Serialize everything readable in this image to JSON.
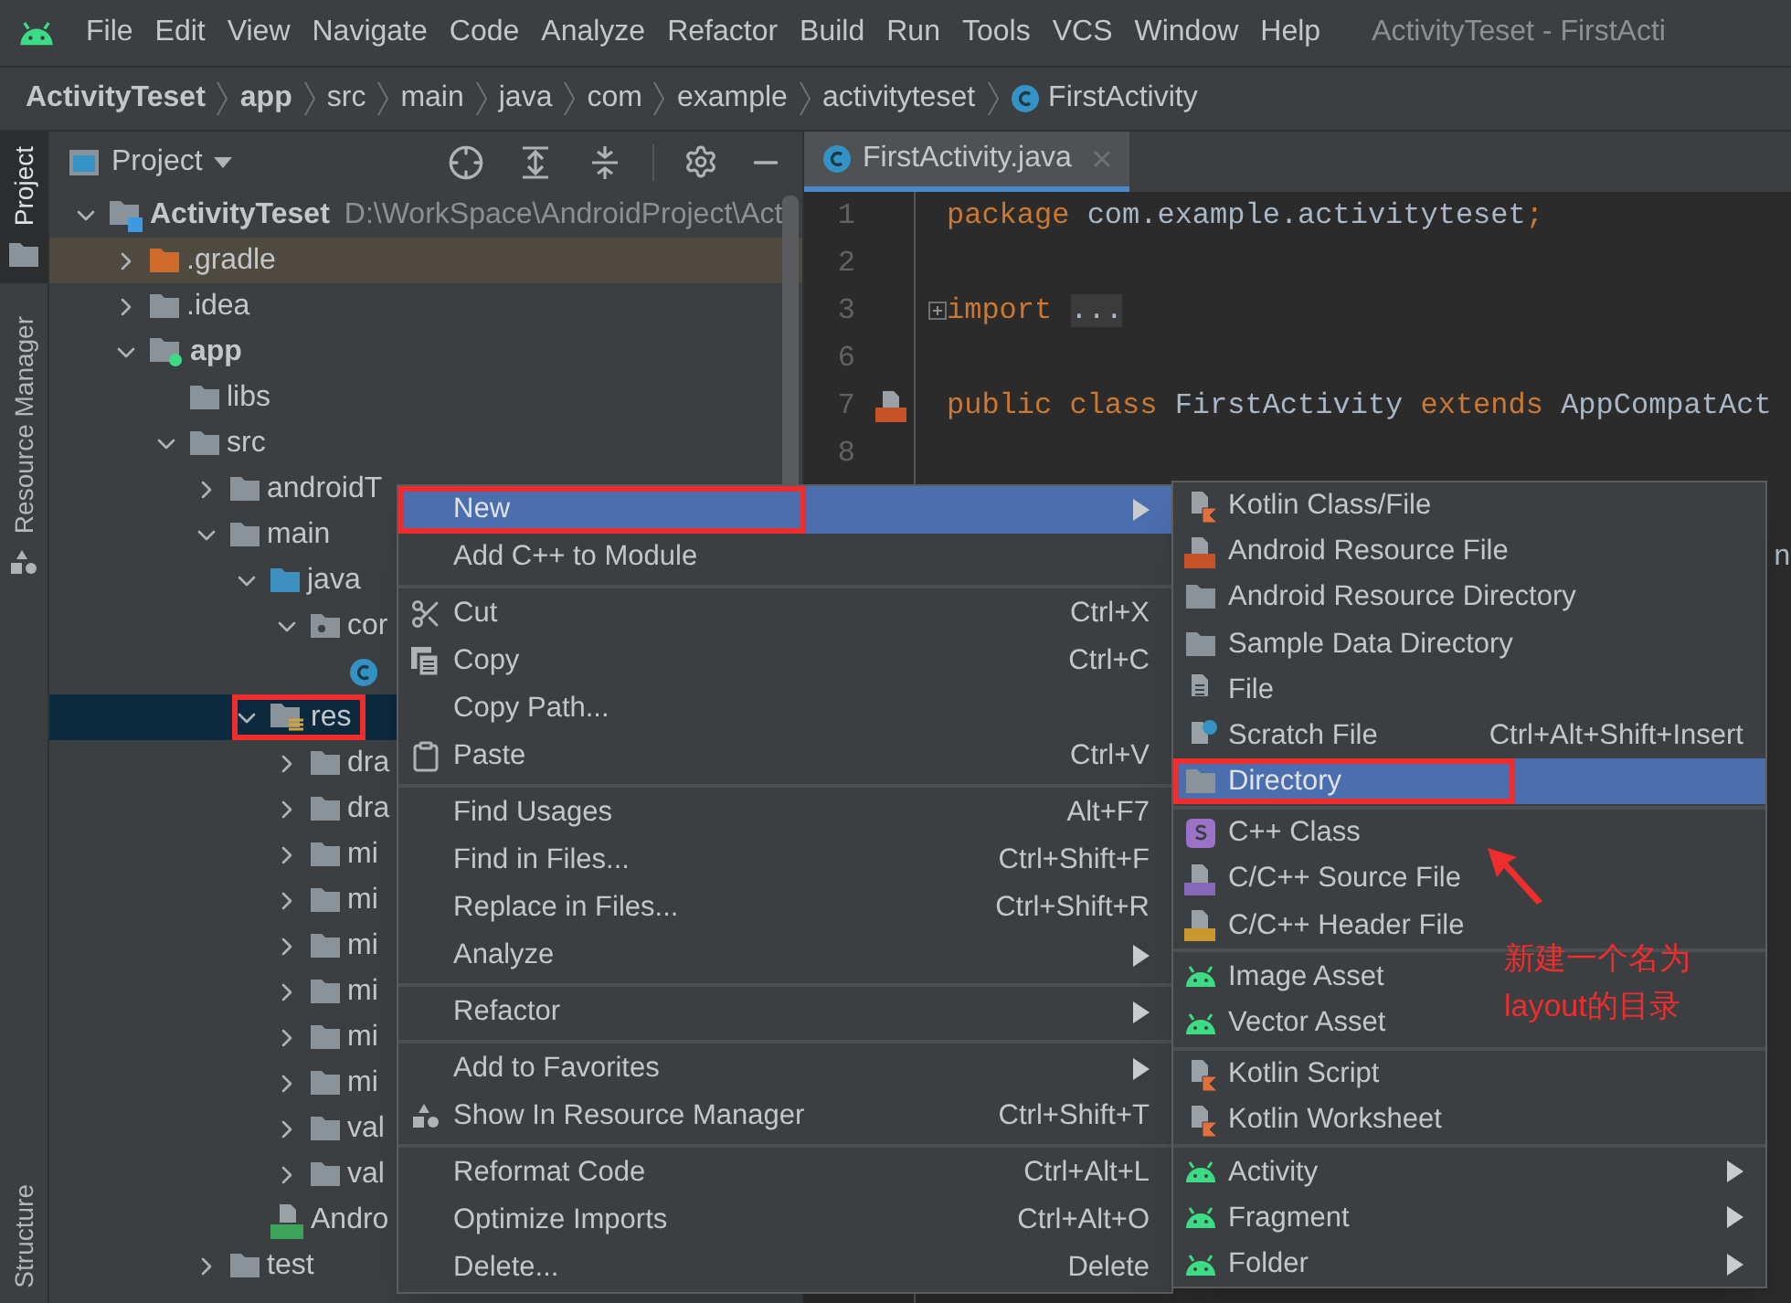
{
  "menu_bar": {
    "items": [
      "File",
      "Edit",
      "View",
      "Navigate",
      "Code",
      "Analyze",
      "Refactor",
      "Build",
      "Run",
      "Tools",
      "VCS",
      "Window",
      "Help"
    ],
    "window_title": "ActivityTeset - FirstActi"
  },
  "breadcrumb": [
    {
      "label": "ActivityTeset",
      "bold": true,
      "kind": "plain"
    },
    {
      "label": "app",
      "bold": true,
      "kind": "plain"
    },
    {
      "label": "src",
      "bold": false,
      "kind": "plain"
    },
    {
      "label": "main",
      "bold": false,
      "kind": "plain"
    },
    {
      "label": "java",
      "bold": false,
      "kind": "plain"
    },
    {
      "label": "com",
      "bold": false,
      "kind": "plain"
    },
    {
      "label": "example",
      "bold": false,
      "kind": "plain"
    },
    {
      "label": "activityteset",
      "bold": false,
      "kind": "plain"
    },
    {
      "label": "FirstActivity",
      "bold": false,
      "kind": "class"
    }
  ],
  "side_stripe": [
    {
      "label": "Project",
      "selected": true
    },
    {
      "label": "Resource Manager",
      "selected": false
    },
    {
      "label": "Structure",
      "selected": false
    }
  ],
  "project_panel": {
    "view": "Project",
    "tree": [
      {
        "label": "ActivityTeset",
        "path": "D:\\WorkSpace\\AndroidProject\\Act",
        "kind": "project",
        "expanded": true,
        "selected": false,
        "framed": false,
        "children": [
          {
            "label": ".gradle",
            "kind": "excluded",
            "expanded": false,
            "selected": false,
            "framed": false
          },
          {
            "label": ".idea",
            "kind": "folder",
            "expanded": false,
            "selected": false,
            "framed": false
          },
          {
            "label": "app",
            "kind": "module",
            "expanded": true,
            "selected": false,
            "framed": false,
            "children": [
              {
                "label": "libs",
                "kind": "folder",
                "selected": false,
                "framed": false
              },
              {
                "label": "src",
                "kind": "folder",
                "expanded": true,
                "selected": false,
                "framed": false,
                "children": [
                  {
                    "label": "androidT",
                    "kind": "folder",
                    "expanded": false,
                    "selected": false,
                    "framed": false
                  },
                  {
                    "label": "main",
                    "kind": "folder",
                    "expanded": true,
                    "selected": false,
                    "framed": false,
                    "children": [
                      {
                        "label": "java",
                        "kind": "source",
                        "expanded": true,
                        "selected": false,
                        "framed": false,
                        "children": [
                          {
                            "label": "cor",
                            "kind": "package",
                            "expanded": true,
                            "selected": false,
                            "framed": false,
                            "children": [
                              {
                                "kind": "class",
                                "selected": false,
                                "framed": false
                              }
                            ]
                          }
                        ]
                      },
                      {
                        "label": "res",
                        "kind": "resources",
                        "expanded": true,
                        "selected": true,
                        "framed": true,
                        "children": [
                          {
                            "label": "dra",
                            "kind": "folder",
                            "expanded": false,
                            "selected": false,
                            "framed": false
                          },
                          {
                            "label": "dra",
                            "kind": "folder",
                            "expanded": false,
                            "selected": false,
                            "framed": false
                          },
                          {
                            "label": "mi",
                            "kind": "folder",
                            "expanded": false,
                            "selected": false,
                            "framed": false
                          },
                          {
                            "label": "mi",
                            "kind": "folder",
                            "expanded": false,
                            "selected": false,
                            "framed": false
                          },
                          {
                            "label": "mi",
                            "kind": "folder",
                            "expanded": false,
                            "selected": false,
                            "framed": false
                          },
                          {
                            "label": "mi",
                            "kind": "folder",
                            "expanded": false,
                            "selected": false,
                            "framed": false
                          },
                          {
                            "label": "mi",
                            "kind": "folder",
                            "expanded": false,
                            "selected": false,
                            "framed": false
                          },
                          {
                            "label": "mi",
                            "kind": "folder",
                            "expanded": false,
                            "selected": false,
                            "framed": false
                          },
                          {
                            "label": "val",
                            "kind": "folder",
                            "expanded": false,
                            "selected": false,
                            "framed": false
                          },
                          {
                            "label": "val",
                            "kind": "folder",
                            "expanded": false,
                            "selected": false,
                            "framed": false
                          }
                        ]
                      },
                      {
                        "label": "Andro",
                        "kind": "manifest",
                        "selected": false,
                        "framed": false
                      }
                    ]
                  },
                  {
                    "label": "test",
                    "kind": "folder",
                    "expanded": false,
                    "selected": false,
                    "framed": false
                  }
                ]
              }
            ]
          }
        ]
      }
    ]
  },
  "editor": {
    "tab": {
      "label": "FirstActivity.java",
      "selected": true
    },
    "lines": [
      {
        "number": "1",
        "tokens": [
          {
            "kind": "keyword",
            "text": "package"
          },
          {
            "kind": "plain",
            "text": " com.example.activityteset"
          },
          {
            "kind": "keyword",
            "text": ";"
          }
        ]
      },
      {
        "number": "2"
      },
      {
        "number": "3",
        "fold": true,
        "tokens": [
          {
            "kind": "keyword",
            "text": "import"
          },
          {
            "kind": "folded",
            "text": "..."
          }
        ]
      },
      {
        "number": "6"
      },
      {
        "number": "7",
        "gutter_icon": true,
        "tokens": [
          {
            "kind": "keyword",
            "text": "public class"
          },
          {
            "kind": "plain",
            "text": " FirstActivity "
          },
          {
            "kind": "keyword",
            "text": "extends"
          },
          {
            "kind": "plain",
            "text": " AppCompatAct"
          }
        ]
      },
      {
        "number": "8"
      }
    ],
    "peek_text": "n"
  },
  "context_menu": {
    "items": [
      {
        "kind": "plain",
        "label": "New",
        "selected": true,
        "framed": true,
        "submenu": true
      },
      {
        "kind": "plain",
        "label": "Add C++ to Module",
        "selected": false,
        "framed": false,
        "submenu": false
      },
      {
        "kind": "separator"
      },
      {
        "kind": "scissors",
        "label": "Cut",
        "shortcut": "Ctrl+X",
        "selected": false,
        "framed": false,
        "submenu": false
      },
      {
        "kind": "copy",
        "label": "Copy",
        "shortcut": "Ctrl+C",
        "selected": false,
        "framed": false,
        "submenu": false
      },
      {
        "kind": "plain",
        "label": "Copy Path...",
        "selected": false,
        "framed": false,
        "submenu": false
      },
      {
        "kind": "clipboard",
        "label": "Paste",
        "shortcut": "Ctrl+V",
        "selected": false,
        "framed": false,
        "submenu": false
      },
      {
        "kind": "separator"
      },
      {
        "kind": "plain",
        "label": "Find Usages",
        "shortcut": "Alt+F7",
        "selected": false,
        "framed": false,
        "submenu": false
      },
      {
        "kind": "plain",
        "label": "Find in Files...",
        "shortcut": "Ctrl+Shift+F",
        "selected": false,
        "framed": false,
        "submenu": false
      },
      {
        "kind": "plain",
        "label": "Replace in Files...",
        "shortcut": "Ctrl+Shift+R",
        "selected": false,
        "framed": false,
        "submenu": false
      },
      {
        "kind": "plain",
        "label": "Analyze",
        "selected": false,
        "framed": false,
        "submenu": true
      },
      {
        "kind": "separator"
      },
      {
        "kind": "plain",
        "label": "Refactor",
        "selected": false,
        "framed": false,
        "submenu": true
      },
      {
        "kind": "separator"
      },
      {
        "kind": "plain",
        "label": "Add to Favorites",
        "selected": false,
        "framed": false,
        "submenu": true
      },
      {
        "kind": "shapes",
        "label": "Show In Resource Manager",
        "shortcut": "Ctrl+Shift+T",
        "selected": false,
        "framed": false,
        "submenu": false
      },
      {
        "kind": "separator"
      },
      {
        "kind": "plain",
        "label": "Reformat Code",
        "shortcut": "Ctrl+Alt+L",
        "selected": false,
        "framed": false,
        "submenu": false
      },
      {
        "kind": "plain",
        "label": "Optimize Imports",
        "shortcut": "Ctrl+Alt+O",
        "selected": false,
        "framed": false,
        "submenu": false
      },
      {
        "kind": "plain",
        "label": "Delete...",
        "shortcut": "Delete",
        "selected": false,
        "framed": false,
        "submenu": false
      }
    ]
  },
  "new_submenu": {
    "items": [
      {
        "kind": "kotlin",
        "label": "Kotlin Class/File",
        "selected": false,
        "framed": false,
        "submenu": false
      },
      {
        "kind": "resource-file",
        "label": "Android Resource File",
        "selected": false,
        "framed": false,
        "submenu": false
      },
      {
        "kind": "folder",
        "label": "Android Resource Directory",
        "selected": false,
        "framed": false,
        "submenu": false
      },
      {
        "kind": "folder",
        "label": "Sample Data Directory",
        "selected": false,
        "framed": false,
        "submenu": false
      },
      {
        "kind": "file",
        "label": "File",
        "selected": false,
        "framed": false,
        "submenu": false
      },
      {
        "kind": "scratch",
        "label": "Scratch File",
        "shortcut": "Ctrl+Alt+Shift+Insert",
        "selected": false,
        "framed": false,
        "submenu": false
      },
      {
        "kind": "folder",
        "label": "Directory",
        "selected": true,
        "framed": true,
        "submenu": false
      },
      {
        "kind": "separator"
      },
      {
        "kind": "s-class",
        "label": "C++ Class",
        "selected": false,
        "framed": false,
        "submenu": false
      },
      {
        "kind": "cpp",
        "label": "C/C++ Source File",
        "selected": false,
        "framed": false,
        "submenu": false
      },
      {
        "kind": "header",
        "label": "C/C++ Header File",
        "selected": false,
        "framed": false,
        "submenu": false
      },
      {
        "kind": "separator"
      },
      {
        "kind": "android",
        "label": "Image Asset",
        "selected": false,
        "framed": false,
        "submenu": false
      },
      {
        "kind": "android",
        "label": "Vector Asset",
        "selected": false,
        "framed": false,
        "submenu": false
      },
      {
        "kind": "separator"
      },
      {
        "kind": "kotlin",
        "label": "Kotlin Script",
        "selected": false,
        "framed": false,
        "submenu": false
      },
      {
        "kind": "kotlin",
        "label": "Kotlin Worksheet",
        "selected": false,
        "framed": false,
        "submenu": false
      },
      {
        "kind": "separator"
      },
      {
        "kind": "android",
        "label": "Activity",
        "selected": false,
        "framed": false,
        "submenu": true
      },
      {
        "kind": "android",
        "label": "Fragment",
        "selected": false,
        "framed": false,
        "submenu": true
      },
      {
        "kind": "android",
        "label": "Folder",
        "selected": false,
        "framed": false,
        "submenu": true
      }
    ]
  },
  "annotation": {
    "lines": [
      "新建一个名为",
      "layout的目录"
    ]
  }
}
